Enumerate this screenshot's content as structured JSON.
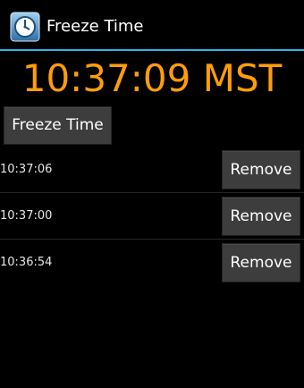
{
  "app": {
    "title": "Freeze Time",
    "icon": "clock-icon",
    "accent_color": "#33b5e5"
  },
  "clock": {
    "time": "10:37:09 MST",
    "color": "#ff9d0a"
  },
  "freeze_button": {
    "label": "Freeze Time"
  },
  "frozen_times": [
    {
      "time": "10:37:06",
      "remove_label": "Remove"
    },
    {
      "time": "10:37:00",
      "remove_label": "Remove"
    },
    {
      "time": "10:36:54",
      "remove_label": "Remove"
    }
  ]
}
